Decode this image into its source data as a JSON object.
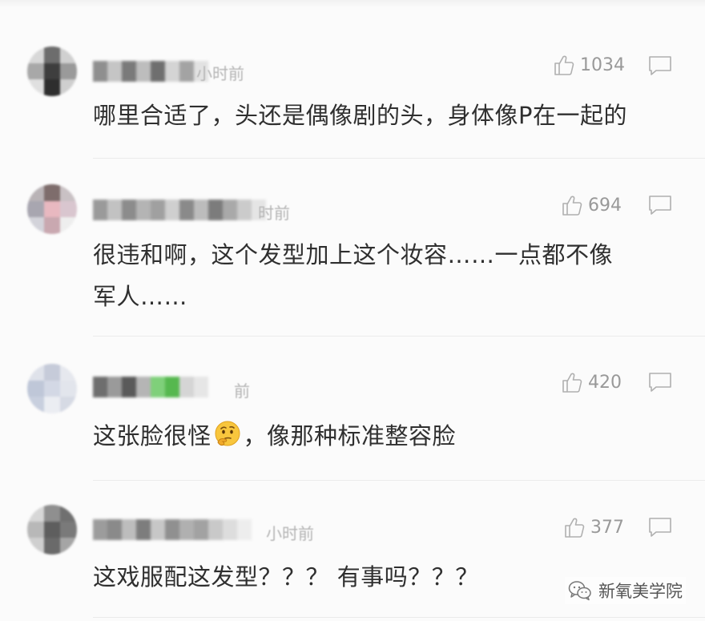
{
  "comments": [
    {
      "time": "小时前",
      "likes": "1034",
      "text": "哪里合适了，头还是偶像剧的头，身体像P在一起的"
    },
    {
      "time": "时前",
      "likes": "694",
      "text_line1": "很违和啊，这个发型加上这个妆容……一点都不像",
      "text_line2": "军人……"
    },
    {
      "time": "前",
      "likes": "420",
      "text_before_emoji": "这张脸很怪",
      "emoji": "thinking-face",
      "text_after_emoji": "，像那种标准整容脸"
    },
    {
      "time": "小时前",
      "likes": "377",
      "text": "这戏服配这发型？？？ 有事吗？？？"
    }
  ],
  "watermark": {
    "text": "新氧美学院",
    "icon": "wechat-icon"
  },
  "colors": {
    "meta_gray": "#999999",
    "time_gray": "#b5b5b5",
    "text": "#2f2f2f",
    "divider": "#ebebeb"
  }
}
